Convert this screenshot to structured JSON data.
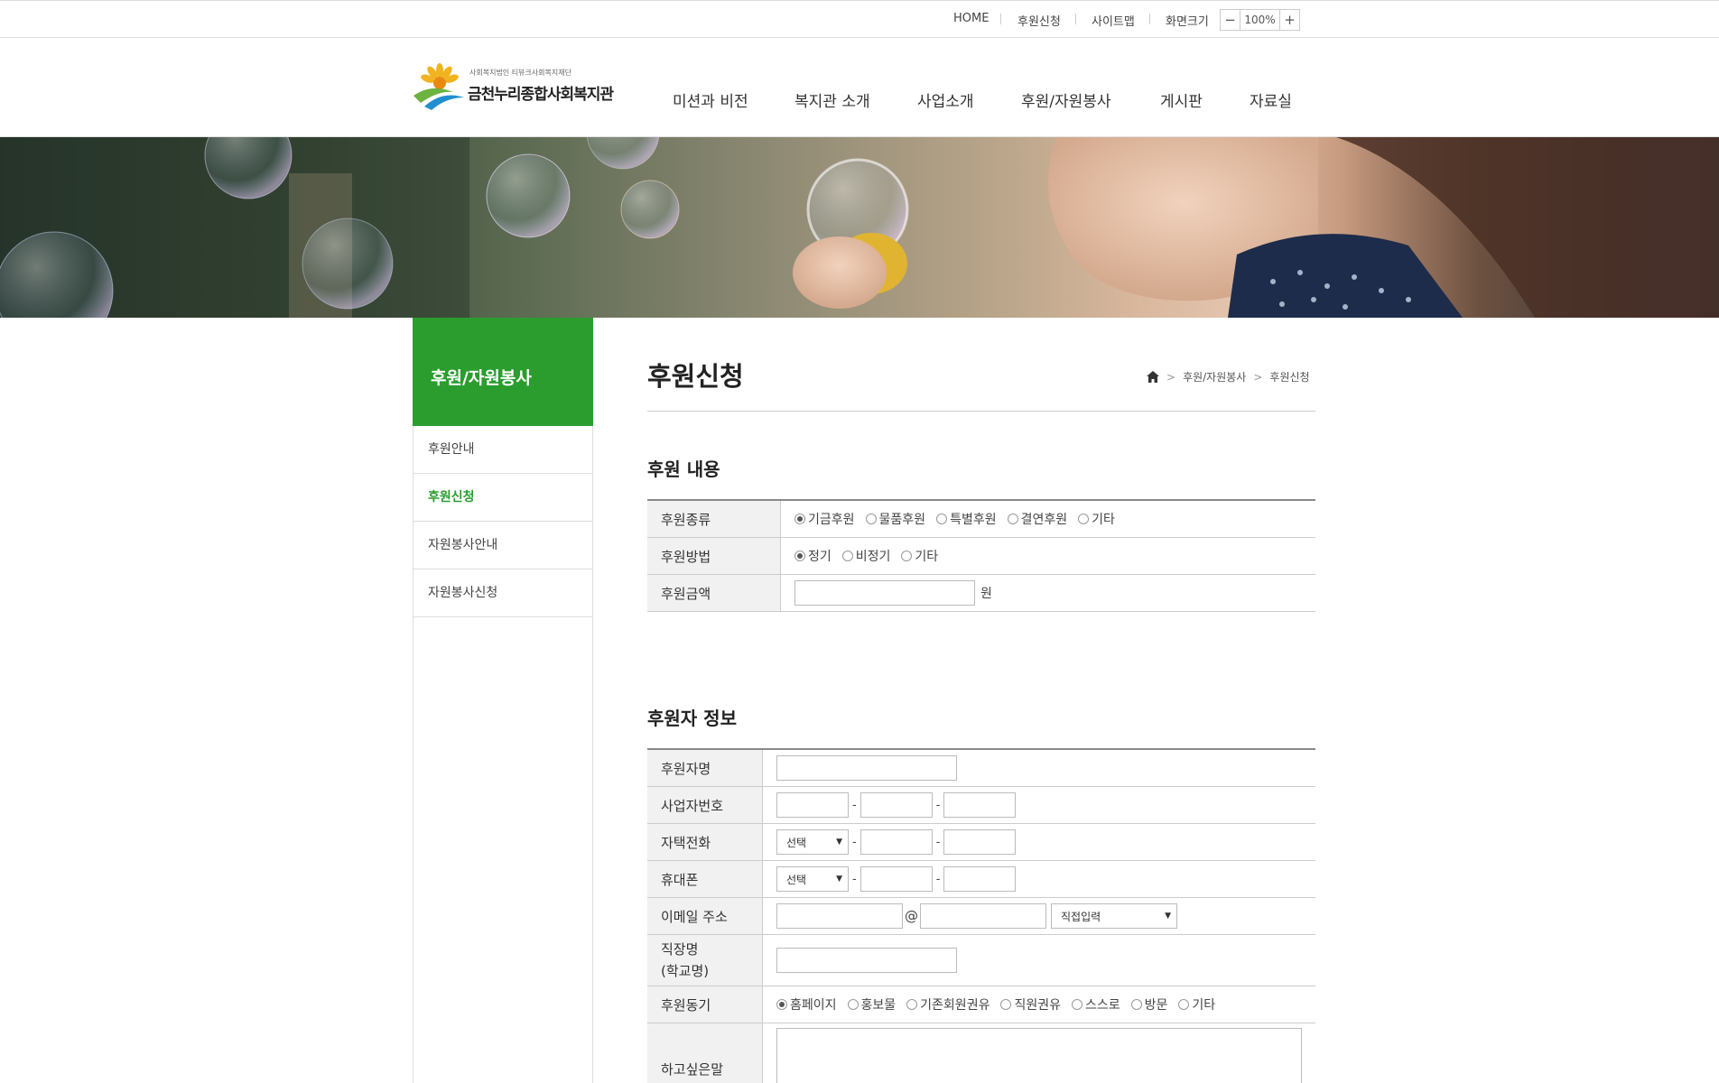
{
  "util": {
    "home": "HOME",
    "donate": "후원신청",
    "sitemap": "사이트맵",
    "screen_size": "화면크기",
    "zoom_minus": "−",
    "zoom_value": "100%",
    "zoom_plus": "+"
  },
  "logo": {
    "sub": "사회복지법인 티뷰크사회복지재단",
    "name": "금천누리종합사회복지관"
  },
  "nav": [
    "미션과 비전",
    "복지관 소개",
    "사업소개",
    "후원/자원봉사",
    "게시판",
    "자료실"
  ],
  "side": {
    "title": "후원/자원봉사",
    "items": [
      {
        "label": "후원안내",
        "active": false
      },
      {
        "label": "후원신청",
        "active": true
      },
      {
        "label": "자원봉사안내",
        "active": false
      },
      {
        "label": "자원봉사신청",
        "active": false
      }
    ]
  },
  "page": {
    "title": "후원신청",
    "breadcrumb": [
      "후원/자원봉사",
      "후원신청"
    ],
    "breadcrumb_sep": ">"
  },
  "donation": {
    "section_title": "후원 내용",
    "type": {
      "label": "후원종류",
      "options": [
        "기금후원",
        "물품후원",
        "특별후원",
        "결연후원",
        "기타"
      ],
      "selected": 0
    },
    "method": {
      "label": "후원방법",
      "options": [
        "정기",
        "비정기",
        "기타"
      ],
      "selected": 0
    },
    "amount": {
      "label": "후원금액",
      "value": "",
      "unit": "원"
    }
  },
  "donor": {
    "section_title": "후원자 정보",
    "name": {
      "label": "후원자명",
      "value": ""
    },
    "bizno": {
      "label": "사업자번호"
    },
    "home_phone": {
      "label": "자택전화",
      "select": "선택"
    },
    "mobile": {
      "label": "휴대폰",
      "select": "선택"
    },
    "email": {
      "label": "이메일 주소",
      "at": "@",
      "domain_select": "직접입력"
    },
    "work_line1": "직장명",
    "work_line2": "(학교명)",
    "motive": {
      "label": "후원동기",
      "options": [
        "홈페이지",
        "홍보물",
        "기존회원권유",
        "직원권유",
        "스스로",
        "방문",
        "기타"
      ],
      "selected": 0
    },
    "message": {
      "label": "하고싶은말",
      "value": ""
    }
  },
  "colors": {
    "accent": "#2a9d2e",
    "header_bg": "#f1f1f1",
    "border": "#cccccc"
  }
}
